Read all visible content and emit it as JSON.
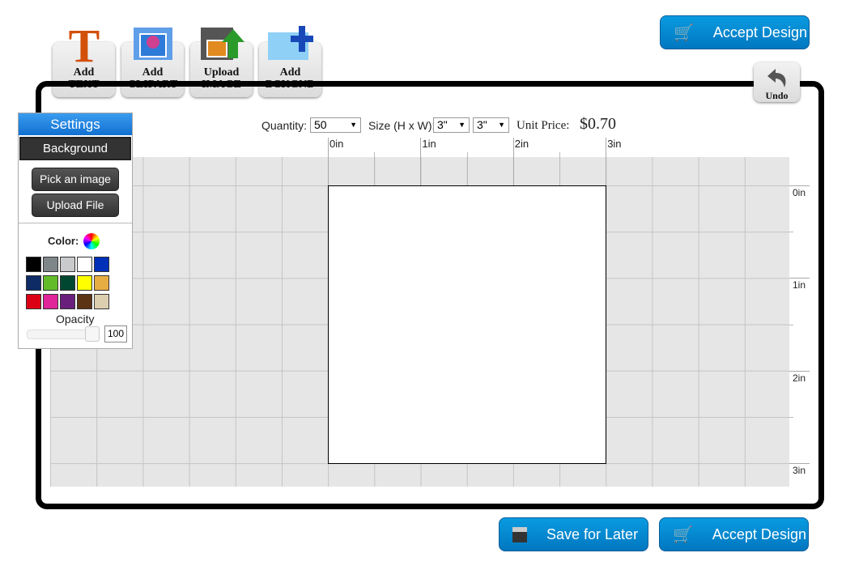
{
  "toolbar": {
    "tools": [
      {
        "l1": "Add",
        "l2": "TEXT",
        "icon": "text-t-icon"
      },
      {
        "l1": "Add",
        "l2": "CLIPART",
        "icon": "clipart-folder-icon"
      },
      {
        "l1": "Upload",
        "l2": "IMAGE",
        "icon": "upload-image-icon"
      },
      {
        "l1": "Add",
        "l2": "BCKGND",
        "icon": "add-background-icon"
      }
    ],
    "undo": "Undo",
    "accept_top": "Accept Design"
  },
  "options": {
    "quantity_label": "Quantity:",
    "quantity": "50",
    "size_label": "Size (H x W):",
    "height": "3\"",
    "width": "3\"",
    "price_label": "Unit Price:",
    "price": "$0.70"
  },
  "rulers": {
    "top": [
      "0in",
      "1in",
      "2in",
      "3in"
    ],
    "right": [
      "0in",
      "1in",
      "2in",
      "3in"
    ]
  },
  "settings": {
    "title": "Settings",
    "tab": "Background",
    "pick": "Pick an image",
    "upload": "Upload File",
    "color_label": "Color:",
    "opacity_label": "Opacity",
    "opacity": "100",
    "swatches": [
      "#000000",
      "#7f868a",
      "#c9cacb",
      "#ffffff",
      "#0030b8",
      "#0e2b66",
      "#63bb2a",
      "#004731",
      "#ffff00",
      "#e8ad42",
      "#dc0014",
      "#e0249a",
      "#6b1f7d",
      "#5c3414",
      "#dccfb0"
    ]
  },
  "footer": {
    "save": "Save for Later",
    "accept": "Accept Design"
  },
  "colors": {
    "accent": "#0088d1",
    "settings_header": "#1f86e0"
  }
}
